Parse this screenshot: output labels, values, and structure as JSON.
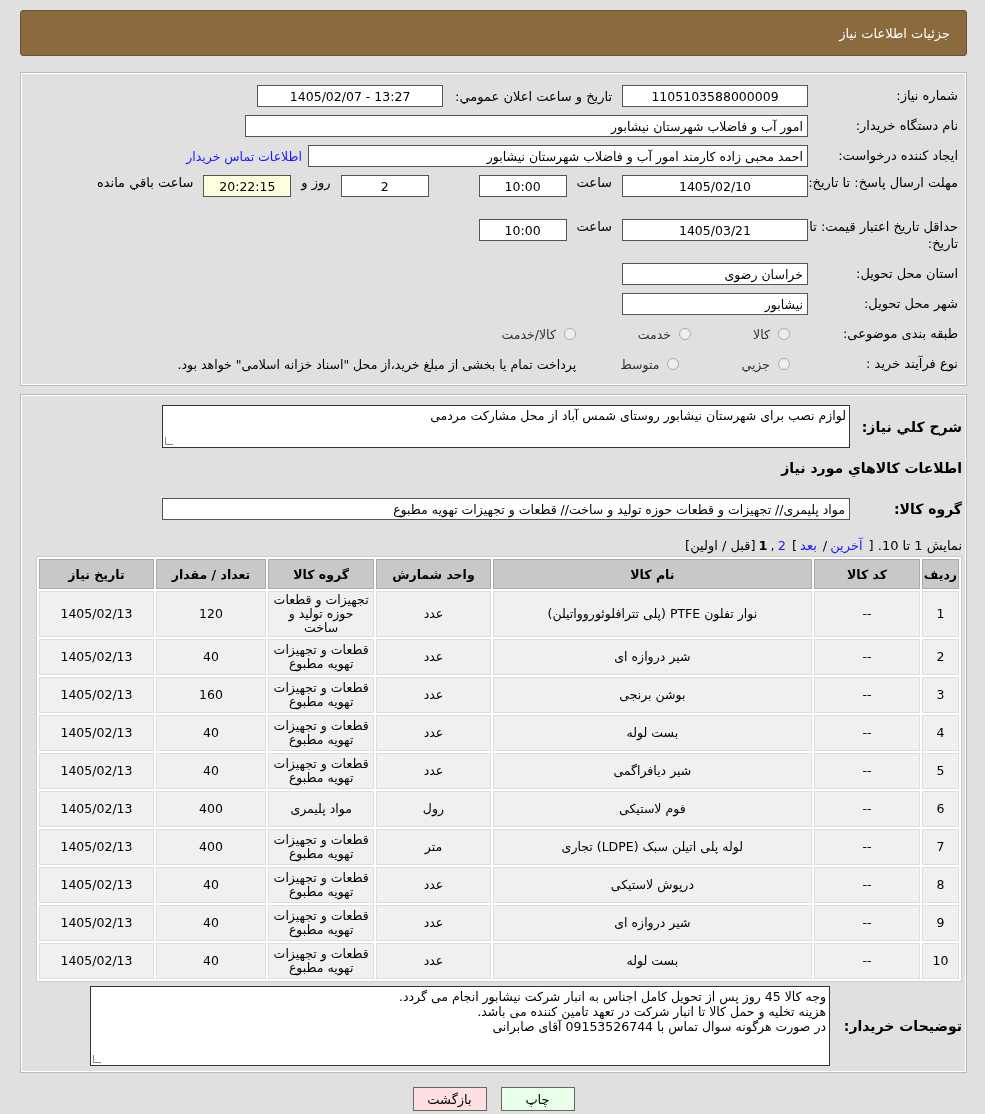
{
  "header": {
    "title": "جزئیات اطلاعات نیاز"
  },
  "details": {
    "need_number": {
      "label": "شماره نیاز:",
      "value": "1105103588000009"
    },
    "announce": {
      "label": "تاریخ و ساعت اعلان عمومي:",
      "value": "1405/02/07 - 13:27"
    },
    "buyer_org": {
      "label": "نام دستگاه خریدار:",
      "value": "امور آب و فاضلاب شهرستان نیشابور"
    },
    "requester": {
      "label": "ایجاد کننده درخواست:",
      "value": "احمد محبی زاده کارمند امور آب و فاضلاب شهرستان نیشابور",
      "link": "اطلاعات تماس خریدار"
    },
    "reply_deadline": {
      "label": "مهلت ارسال پاسخ: تا تاریخ:",
      "date": "1405/02/10",
      "time_label": "ساعت",
      "time": "10:00",
      "days": "2",
      "days_label": "روز و",
      "remaining": "20:22:15",
      "remaining_label": "ساعت باقي مانده"
    },
    "price_validity": {
      "label": "حداقل تاریخ اعتبار قیمت: تا تاریخ:",
      "date": "1405/03/21",
      "time_label": "ساعت",
      "time": "10:00"
    },
    "province": {
      "label": "استان محل تحویل:",
      "value": "خراسان رضوی"
    },
    "city": {
      "label": "شهر محل تحویل:",
      "value": "نیشابور"
    },
    "category": {
      "label": "طبقه بندی موضوعی:",
      "options": [
        {
          "label": "کالا",
          "selected": false
        },
        {
          "label": "خدمت",
          "selected": false
        },
        {
          "label": "کالا/خدمت",
          "selected": false
        }
      ]
    },
    "purchase_type": {
      "label": "نوع فرآیند خرید :",
      "options": [
        {
          "label": "جزيي",
          "selected": false
        },
        {
          "label": "متوسط",
          "selected": false
        }
      ],
      "note": "پرداخت تمام یا بخشی از مبلغ خرید،از محل \"اسناد خزانه اسلامی\" خواهد بود."
    }
  },
  "summary": {
    "label": "شرح کلي نیاز:",
    "value": "لوازم نصب برای شهرستان نیشابور روستای شمس آباد از محل مشارکت مردمی"
  },
  "goods_title": "اطلاعات کالاهاي مورد نیاز",
  "goods_group": {
    "label": "گروه کالا:",
    "value": "مواد پلیمری// تجهیزات و قطعات حوزه تولید و ساخت//  قطعات و تجهیزات تهویه مطبوع"
  },
  "pagination": [
    {
      "kind": "text",
      "text": "نمایش 1 تا 10. ["
    },
    {
      "kind": "link",
      "text": "آخرین"
    },
    {
      "kind": "text",
      "text": "/"
    },
    {
      "kind": "link",
      "text": "بعد"
    },
    {
      "kind": "text",
      "text": "]"
    },
    {
      "kind": "link",
      "text": "2"
    },
    {
      "kind": "text",
      "text": ","
    },
    {
      "kind": "current",
      "text": "1"
    },
    {
      "kind": "text",
      "text": "[قبل / اولین]"
    }
  ],
  "table": {
    "columns": [
      "ردیف",
      "کد کالا",
      "نام کالا",
      "واحد شمارش",
      "گروه کالا",
      "تعداد / مقدار",
      "تاریخ نیاز"
    ],
    "rows": [
      [
        "1",
        "--",
        "نوار تفلون PTFE (پلی تترافلوئوروواتیلن)",
        "عدد",
        "تجهیزات و قطعات حوزه تولید و ساخت",
        "120",
        "1405/02/13"
      ],
      [
        "2",
        "--",
        "شیر دروازه ای",
        "عدد",
        "قطعات و تجهیزات تهویه مطبوع",
        "40",
        "1405/02/13"
      ],
      [
        "3",
        "--",
        "بوشن برنجی",
        "عدد",
        "قطعات و تجهیزات تهویه مطبوع",
        "160",
        "1405/02/13"
      ],
      [
        "4",
        "--",
        "بست لوله",
        "عدد",
        "قطعات و تجهیزات تهویه مطبوع",
        "40",
        "1405/02/13"
      ],
      [
        "5",
        "--",
        "شیر دیافراگمی",
        "عدد",
        "قطعات و تجهیزات تهویه مطبوع",
        "40",
        "1405/02/13"
      ],
      [
        "6",
        "--",
        "فوم لاستیکی",
        "رول",
        "مواد پلیمری",
        "400",
        "1405/02/13"
      ],
      [
        "7",
        "--",
        "لوله پلی اتیلن سبک (LDPE) تجاری",
        "متر",
        "قطعات و تجهیزات تهویه مطبوع",
        "400",
        "1405/02/13"
      ],
      [
        "8",
        "--",
        "درپوش لاستیکی",
        "عدد",
        "قطعات و تجهیزات تهویه مطبوع",
        "40",
        "1405/02/13"
      ],
      [
        "9",
        "--",
        "شیر دروازه ای",
        "عدد",
        "قطعات و تجهیزات تهویه مطبوع",
        "40",
        "1405/02/13"
      ],
      [
        "10",
        "--",
        "بست لوله",
        "عدد",
        "قطعات و تجهیزات تهویه مطبوع",
        "40",
        "1405/02/13"
      ]
    ]
  },
  "buyer_notes": {
    "label": "توضیحات خریدار:",
    "lines": [
      "وجه کالا 45 روز پس از تحویل کامل اجناس به انبار شرکت  نیشابور انجام می گردد.",
      "هزینه تخلیه و حمل کالا تا انبار شرکت در تعهد تامین کننده می باشد.",
      "در صورت هرگونه سوال تماس با 09153526744 آقای صابرانی"
    ]
  },
  "buttons": [
    {
      "kind": "print",
      "label": "چاپ"
    },
    {
      "kind": "back",
      "label": "بازگشت"
    }
  ]
}
